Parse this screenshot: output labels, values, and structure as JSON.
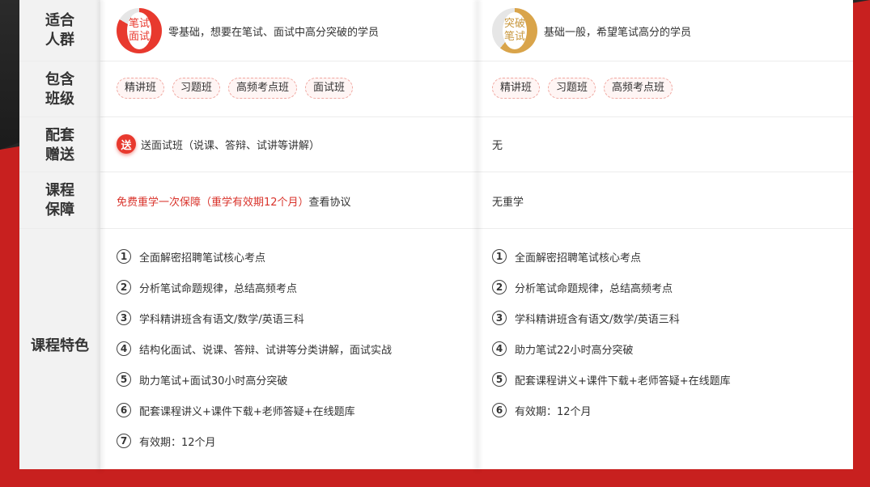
{
  "rows": {
    "audience": {
      "label": "适合人群",
      "col1": {
        "badge": "笔试面试",
        "text": "零基础，想要在笔试、面试中高分突破的学员"
      },
      "col2": {
        "badge": "突破笔试",
        "text": "基础一般，希望笔试高分的学员"
      }
    },
    "classes": {
      "label": "包含班级",
      "col1": [
        "精讲班",
        "习题班",
        "高频考点班",
        "面试班"
      ],
      "col2": [
        "精讲班",
        "习题班",
        "高频考点班"
      ]
    },
    "gift": {
      "label": "配套赠送",
      "col1": {
        "badge": "送",
        "text": "送面试班（说课、答辩、试讲等讲解）"
      },
      "col2": "无"
    },
    "guarantee": {
      "label": "课程保障",
      "col1": {
        "highlight": "免费重学一次保障（重学有效期12个月）",
        "link": "查看协议"
      },
      "col2": "无重学"
    },
    "features": {
      "label": "课程特色",
      "col1": [
        {
          "n": "1",
          "text": "全面解密招聘笔试核心考点"
        },
        {
          "n": "2",
          "text": "分析笔试命题规律，总结高频考点"
        },
        {
          "n": "3",
          "text": "学科精讲班含有语文/数学/英语三科"
        },
        {
          "n": "4",
          "text": "结构化面试、说课、答辩、试讲等分类讲解，面试实战"
        },
        {
          "n": "5",
          "text": "助力笔试+面试30小时高分突破"
        },
        {
          "n": "6",
          "text": "配套课程讲义+课件下载+老师答疑+在线题库"
        },
        {
          "n": "7",
          "text": "有效期：12个月"
        }
      ],
      "col2": [
        {
          "n": "1",
          "text": "全面解密招聘笔试核心考点"
        },
        {
          "n": "2",
          "text": "分析笔试命题规律，总结高频考点"
        },
        {
          "n": "3",
          "text": "学科精讲班含有语文/数学/英语三科"
        },
        {
          "n": "4",
          "text": "助力笔试22小时高分突破"
        },
        {
          "n": "5",
          "text": "配套课程讲义+课件下载+老师答疑+在线题库"
        },
        {
          "n": "6",
          "text": "有效期：12个月"
        }
      ]
    }
  },
  "colors": {
    "accent_red": "#e8392e",
    "accent_gold": "#d9a44a",
    "background_red": "#c8201f"
  }
}
